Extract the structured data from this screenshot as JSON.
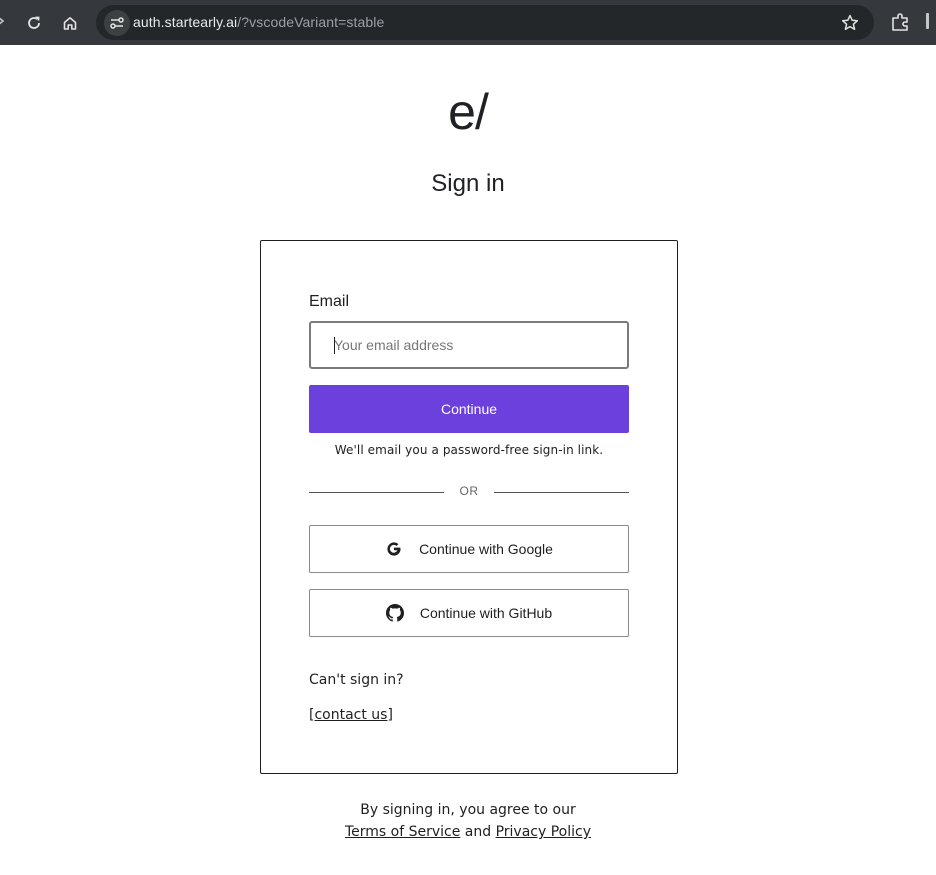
{
  "browser": {
    "url_host": "auth.startearly.ai",
    "url_rest": "/?vscodeVariant=stable",
    "icons": [
      "arrow-edge-icon",
      "reload-icon",
      "home-icon",
      "site-info-icon",
      "bookmark-star-icon",
      "extensions-icon"
    ]
  },
  "page": {
    "logo": "e/",
    "title": "Sign in"
  },
  "form": {
    "email_label": "Email",
    "email_placeholder": "Your email address",
    "email_value": "",
    "continue_label": "Continue",
    "hint": "We'll email you a password-free sign-in link.",
    "divider_text": "OR",
    "google_label": "Continue with Google",
    "github_label": "Continue with GitHub",
    "cant_sign_in": "Can't sign in?",
    "contact_label": "[contact us]"
  },
  "footer": {
    "agree_text": "By signing in, you agree to our",
    "terms_label": "Terms of Service",
    "and_text": "and",
    "privacy_label": "Privacy Policy"
  },
  "colors": {
    "accent": "#6c40dc",
    "chrome_bg": "#35393e",
    "urlbar_bg": "#242729"
  }
}
